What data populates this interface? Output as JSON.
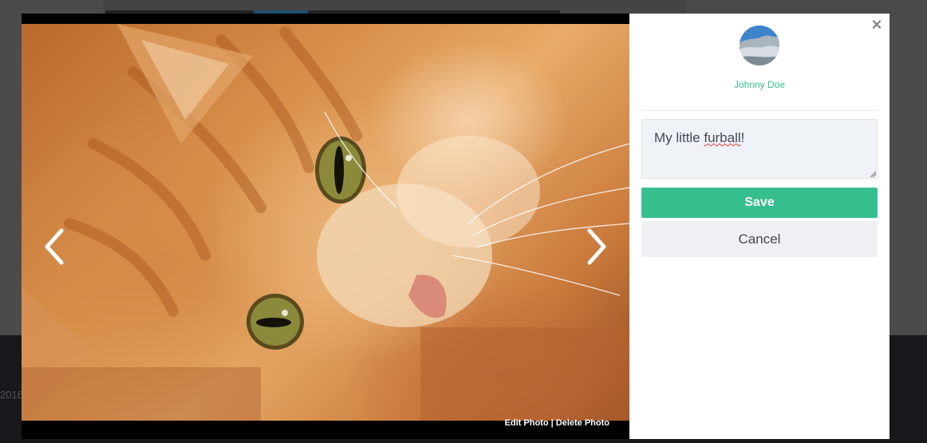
{
  "background_page": {
    "footer_text": "2016"
  },
  "lightbox": {
    "photo": {
      "subject": "orange tabby cat lying down",
      "alt": "Orange tabby cat"
    },
    "actions": {
      "edit_label": "Edit Photo",
      "separator": " | ",
      "delete_label": "Delete Photo"
    },
    "nav": {
      "prev_icon": "chevron-left-icon",
      "next_icon": "chevron-right-icon"
    }
  },
  "side_panel": {
    "close_glyph": "×",
    "user": {
      "name": "Johnny Doe"
    },
    "caption": {
      "value_before": "My little ",
      "value_misspelled": "furball",
      "value_after": "!"
    },
    "save_label": "Save",
    "cancel_label": "Cancel"
  },
  "colors": {
    "accent": "#36bf8d",
    "panel_bg": "#ffffff",
    "input_bg": "#eff2f7",
    "cancel_bg": "#eef0f3",
    "text": "#434a54",
    "spell_error": "#e0403a"
  }
}
